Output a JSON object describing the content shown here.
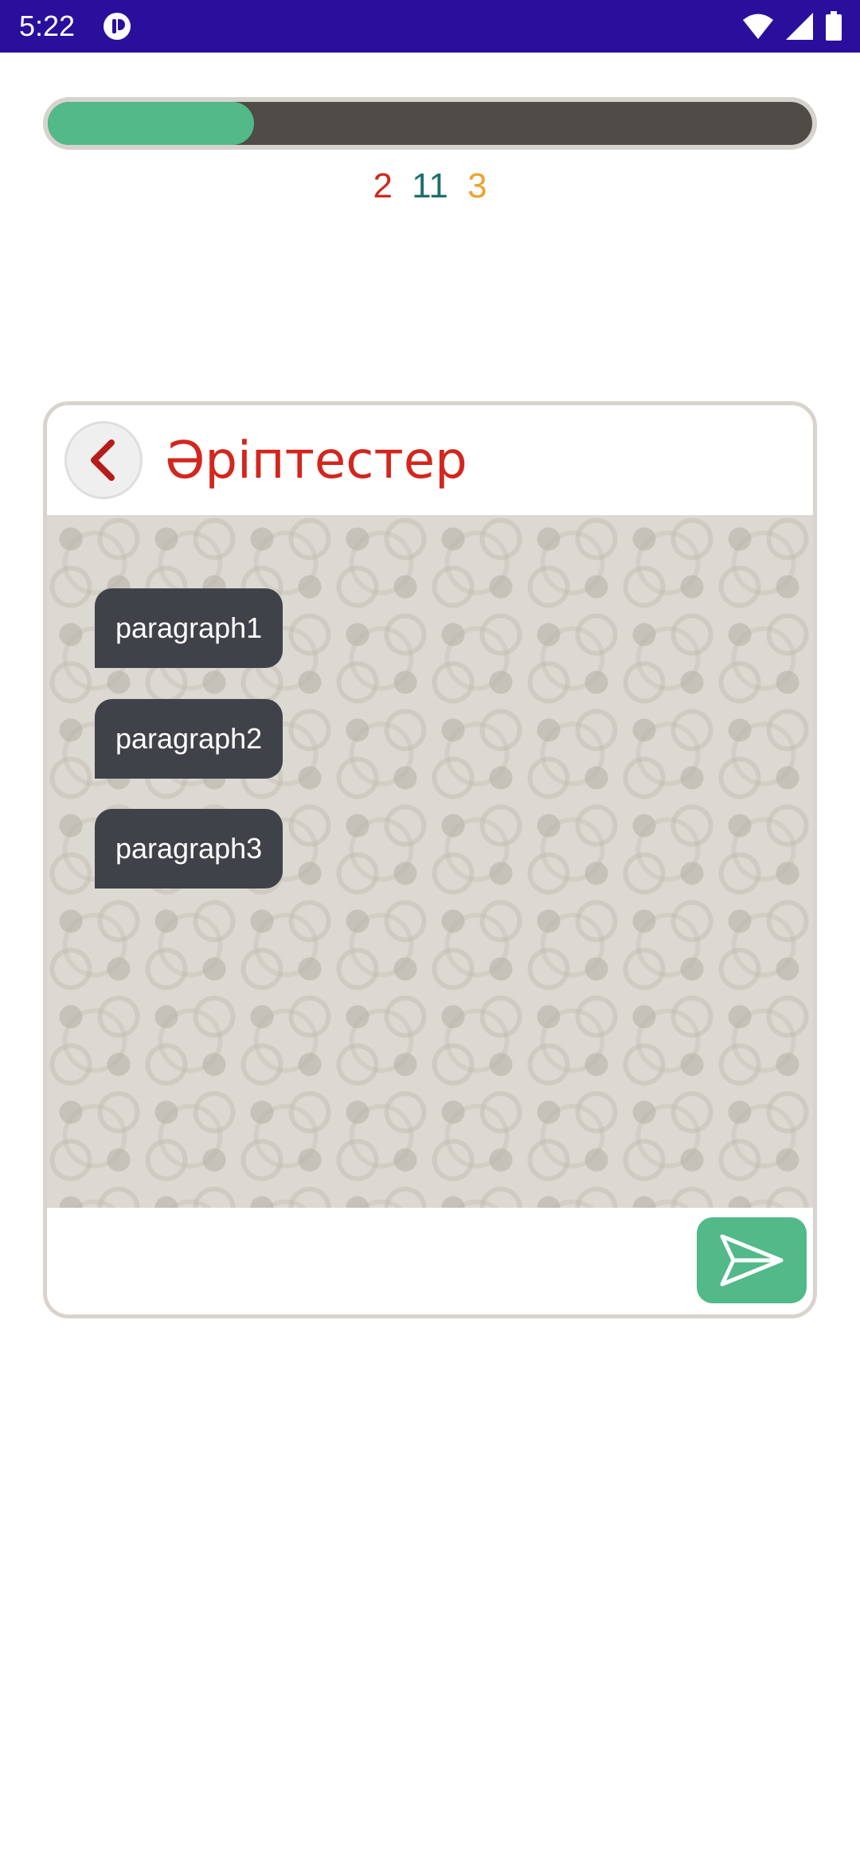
{
  "status_bar": {
    "time": "5:22",
    "app_icon": "app-notification-icon",
    "wifi_icon": "wifi-icon",
    "signal_icon": "cellular-signal-icon",
    "battery_icon": "battery-icon",
    "background_color": "#2a0f9c"
  },
  "progress": {
    "fraction": 0.27,
    "fill_color": "#52b988",
    "track_color": "#4f4b46"
  },
  "scores": {
    "wrong": "2",
    "total": "11",
    "pending": "3",
    "wrong_color": "#d3261e",
    "total_color": "#1f6e6b",
    "pending_color": "#f1a130"
  },
  "chat": {
    "back_icon": "chevron-left-icon",
    "title": "Әріптестер",
    "messages": [
      {
        "text": "paragraph1"
      },
      {
        "text": "paragraph2"
      },
      {
        "text": "paragraph3"
      }
    ],
    "input_value": "",
    "send_icon": "send-icon",
    "send_color": "#52b988"
  }
}
